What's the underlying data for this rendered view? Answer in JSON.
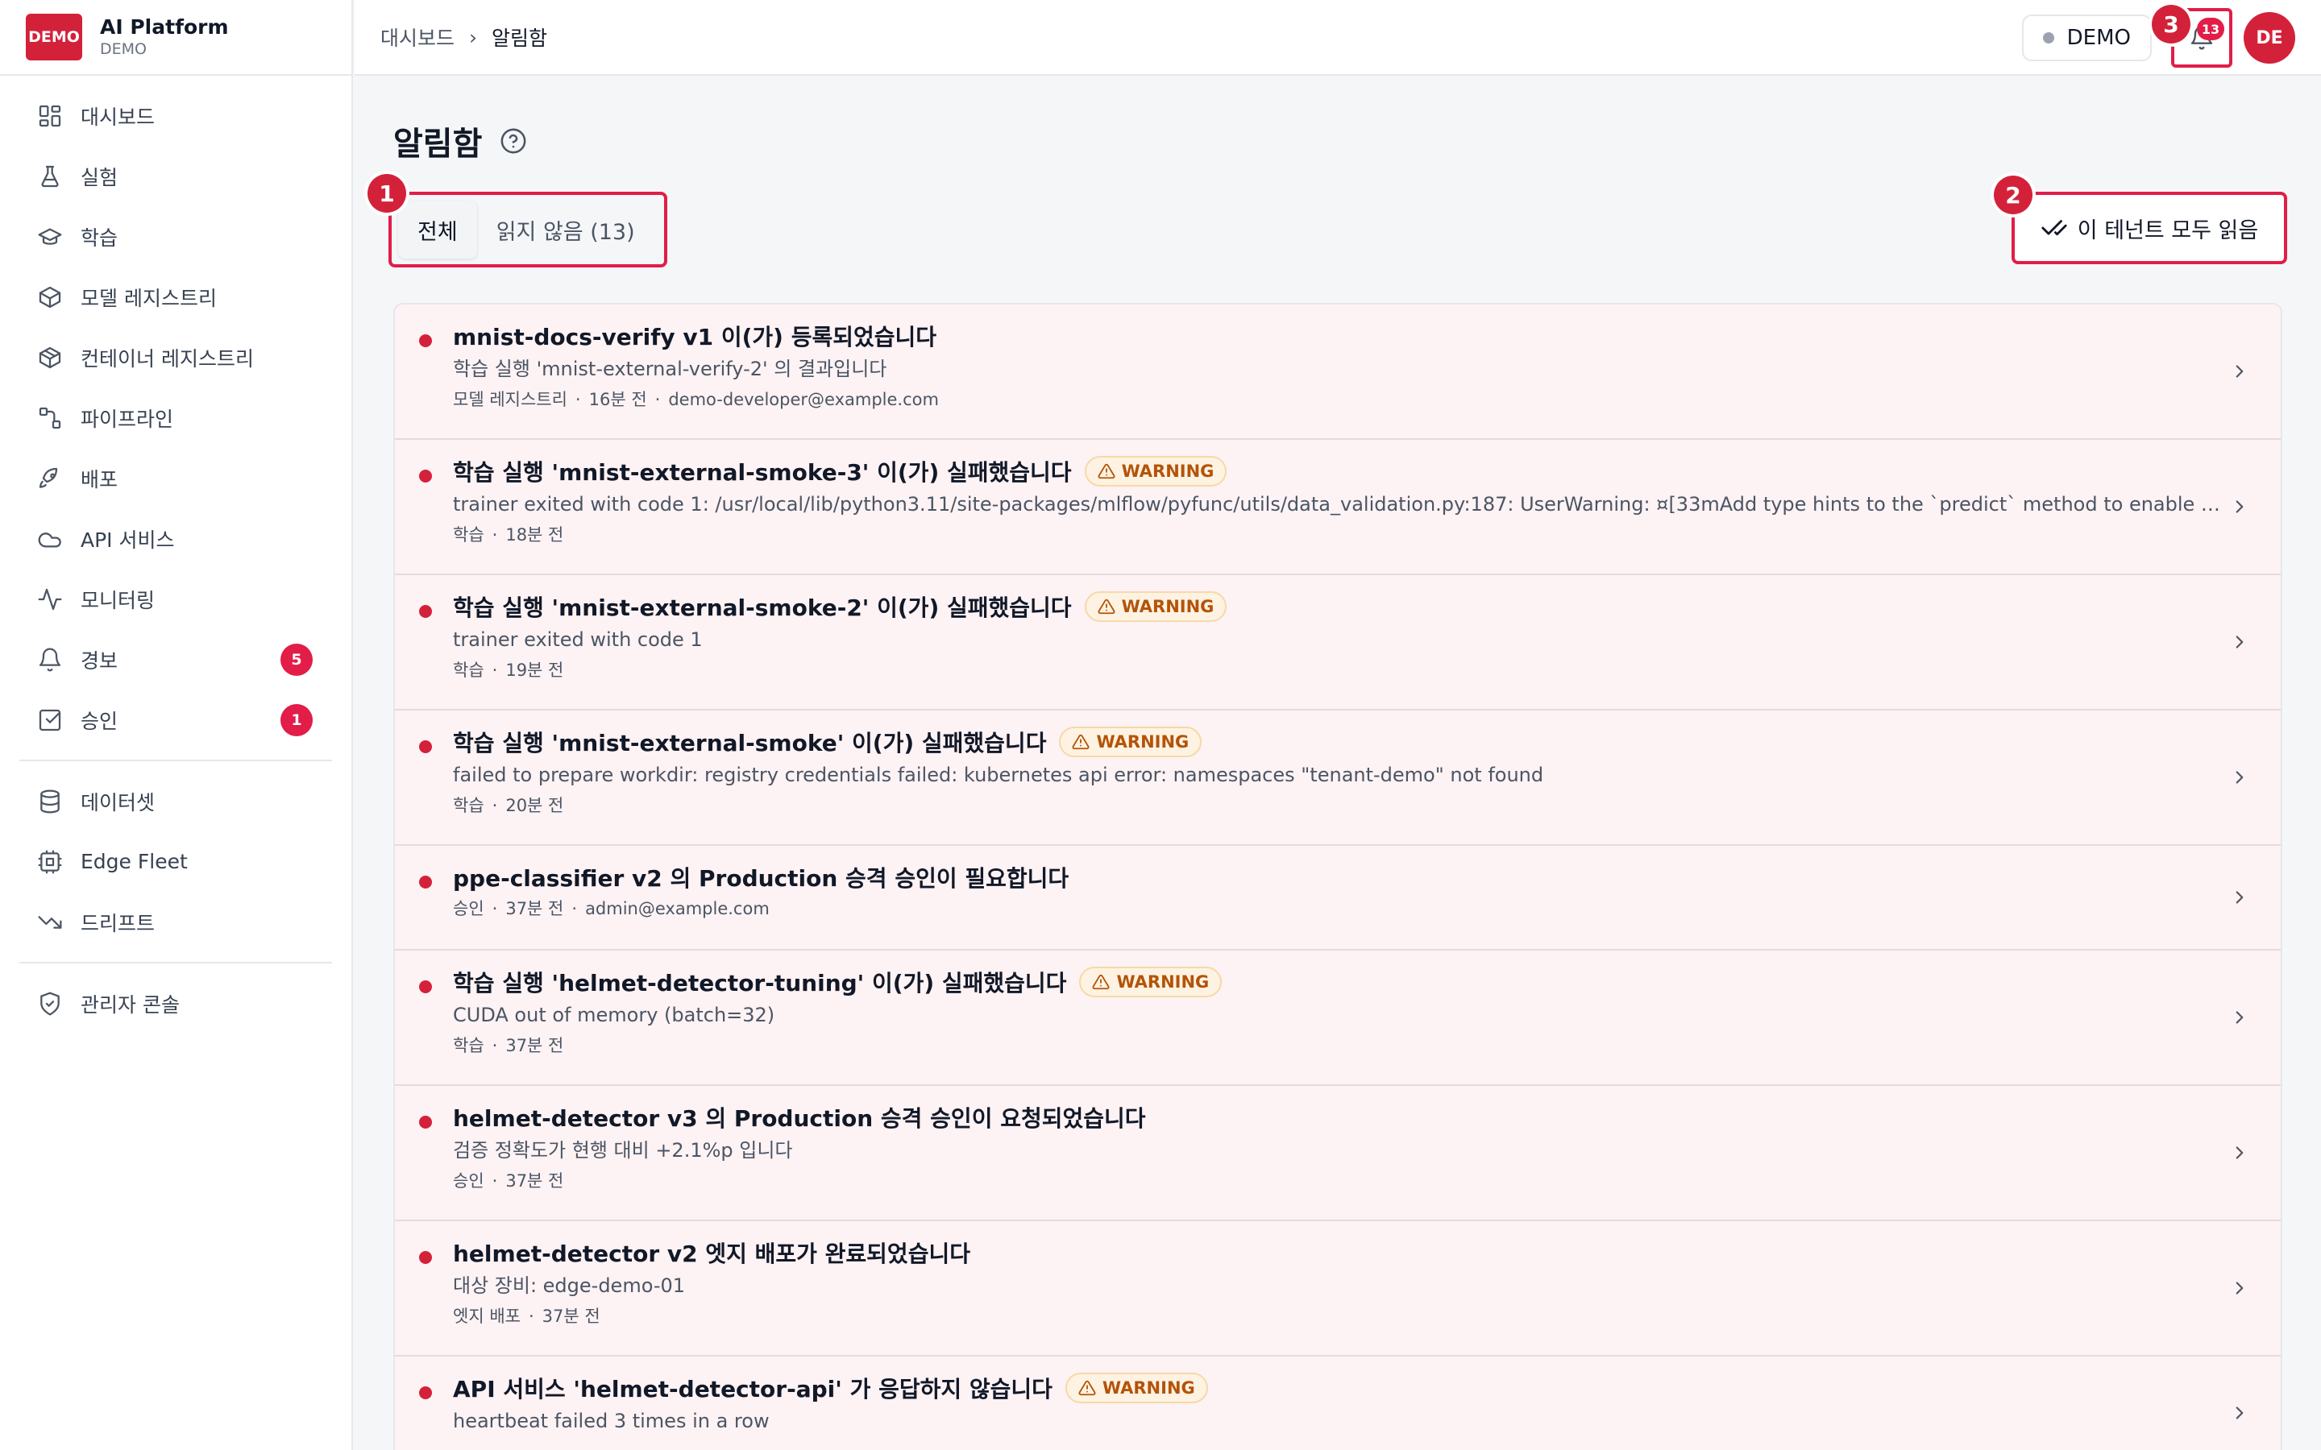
{
  "brand": {
    "logo": "DEMO",
    "name": "AI Platform",
    "sub": "DEMO"
  },
  "sidebar": {
    "sections": [
      {
        "items": [
          {
            "label": "대시보드",
            "icon": "dashboard-icon"
          },
          {
            "label": "실험",
            "icon": "flask-icon"
          },
          {
            "label": "학습",
            "icon": "graduation-cap-icon"
          },
          {
            "label": "모델 레지스트리",
            "icon": "cube-icon"
          },
          {
            "label": "컨테이너 레지스트리",
            "icon": "boxes-icon"
          },
          {
            "label": "파이프라인",
            "icon": "pipeline-icon"
          },
          {
            "label": "배포",
            "icon": "rocket-icon"
          },
          {
            "label": "API 서비스",
            "icon": "cloud-icon"
          },
          {
            "label": "모니터링",
            "icon": "activity-icon"
          },
          {
            "label": "경보",
            "icon": "bell-icon",
            "badge": "5"
          },
          {
            "label": "승인",
            "icon": "check-square-icon",
            "badge": "1"
          }
        ]
      },
      {
        "items": [
          {
            "label": "데이터셋",
            "icon": "database-icon"
          },
          {
            "label": "Edge Fleet",
            "icon": "edge-device-icon"
          },
          {
            "label": "드리프트",
            "icon": "trending-down-icon"
          }
        ]
      },
      {
        "items": [
          {
            "label": "관리자 콘솔",
            "icon": "shield-icon"
          }
        ]
      }
    ]
  },
  "topbar": {
    "breadcrumb_home": "대시보드",
    "breadcrumb_sep": "›",
    "breadcrumb_current": "알림함",
    "tenant": "DEMO",
    "notification_count": "13",
    "avatar": "DE"
  },
  "markers": {
    "m1": "1",
    "m2": "2",
    "m3": "3"
  },
  "page": {
    "title": "알림함",
    "tabs": [
      {
        "label": "전체",
        "active": true
      },
      {
        "label": "읽지 않음 (13)",
        "active": false
      }
    ],
    "mark_all_label": "이 테넌트 모두 읽음"
  },
  "notifications": [
    {
      "title": "mnist-docs-verify v1 이(가) 등록되었습니다",
      "desc": "학습 실행 'mnist-external-verify-2' 의 결과입니다",
      "meta": [
        "모델 레지스트리",
        "16분 전",
        "demo-developer@example.com"
      ],
      "size": "tall"
    },
    {
      "title": "학습 실행 'mnist-external-smoke-3' 이(가) 실패했습니다",
      "badge": "WARNING",
      "desc": "trainer exited with code 1: /usr/local/lib/python3.11/site-packages/mlflow/pyfunc/utils/data_validation.py:187: UserWarning: ¤[33mAdd type hints to the `predict` method to enable data validati...",
      "meta": [
        "학습",
        "18분 전"
      ],
      "size": "tall"
    },
    {
      "title": "학습 실행 'mnist-external-smoke-2' 이(가) 실패했습니다",
      "badge": "WARNING",
      "desc": "trainer exited with code 1",
      "meta": [
        "학습",
        "19분 전"
      ],
      "size": "tall"
    },
    {
      "title": "학습 실행 'mnist-external-smoke' 이(가) 실패했습니다",
      "badge": "WARNING",
      "desc": "failed to prepare workdir: registry credentials failed: kubernetes api error: namespaces \"tenant-demo\" not found",
      "meta": [
        "학습",
        "20분 전"
      ],
      "size": "tall"
    },
    {
      "title": "ppe-classifier v2 의 Production 승격 승인이 필요합니다",
      "meta": [
        "승인",
        "37분 전",
        "admin@example.com"
      ],
      "size": "short"
    },
    {
      "title": "학습 실행 'helmet-detector-tuning' 이(가) 실패했습니다",
      "badge": "WARNING",
      "desc": "CUDA out of memory (batch=32)",
      "meta": [
        "학습",
        "37분 전"
      ],
      "size": "tall"
    },
    {
      "title": "helmet-detector v3 의 Production 승격 승인이 요청되었습니다",
      "desc": "검증 정확도가 현행 대비 +2.1%p 입니다",
      "meta": [
        "승인",
        "37분 전"
      ],
      "size": "tall"
    },
    {
      "title": "helmet-detector v2 엣지 배포가 완료되었습니다",
      "desc": "대상 장비: edge-demo-01",
      "meta": [
        "엣지 배포",
        "37분 전"
      ],
      "size": "tall"
    },
    {
      "title": "API 서비스 'helmet-detector-api' 가 응답하지 않습니다",
      "badge": "WARNING",
      "desc": "heartbeat failed 3 times in a row",
      "meta": [],
      "size": "last"
    }
  ],
  "colors": {
    "accent": "#d4213a",
    "badge_bg": "#e11d48",
    "warning_text": "#b45309",
    "unread_row_bg": "#fdf2f4"
  }
}
